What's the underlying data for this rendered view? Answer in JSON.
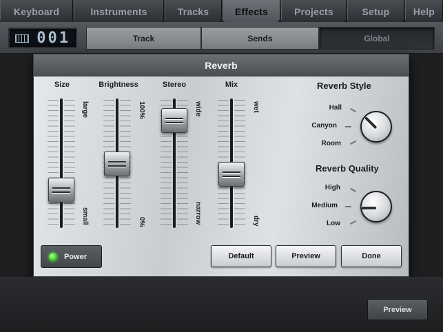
{
  "tabs": [
    {
      "label": "Keyboard",
      "active": false
    },
    {
      "label": "Instruments",
      "active": false
    },
    {
      "label": "Tracks",
      "active": false
    },
    {
      "label": "Effects",
      "active": true
    },
    {
      "label": "Projects",
      "active": false
    },
    {
      "label": "Setup",
      "active": false
    },
    {
      "label": "Help",
      "active": false
    }
  ],
  "display": {
    "number": "001",
    "icon": "keyboard-icon"
  },
  "segments": [
    {
      "label": "Track",
      "selected": false
    },
    {
      "label": "Sends",
      "selected": false
    },
    {
      "label": "Global",
      "selected": true
    }
  ],
  "dialog": {
    "title": "Reverb",
    "sliders": [
      {
        "label": "Size",
        "top_label": "large",
        "bottom_label": "small",
        "value": 0.25
      },
      {
        "label": "Brightness",
        "top_label": "100%",
        "bottom_label": "0%",
        "value": 0.5
      },
      {
        "label": "Stereo",
        "top_label": "wide",
        "bottom_label": "narrow",
        "value": 0.92
      },
      {
        "label": "Mix",
        "top_label": "wet",
        "bottom_label": "dry",
        "value": 0.4
      }
    ],
    "reverb_style": {
      "title": "Reverb Style",
      "options": [
        "Hall",
        "Canyon",
        "Room"
      ],
      "selected": "Canyon"
    },
    "reverb_quality": {
      "title": "Reverb Quality",
      "options": [
        "High",
        "Medium",
        "Low"
      ],
      "selected": "Medium"
    },
    "power": {
      "label": "Power",
      "on": true
    },
    "buttons": {
      "default": "Default",
      "preview": "Preview",
      "done": "Done"
    }
  },
  "bottom": {
    "preview": "Preview"
  },
  "colors": {
    "led": "#3bcf2a",
    "dialog_title_bg": "#5a5e63"
  }
}
